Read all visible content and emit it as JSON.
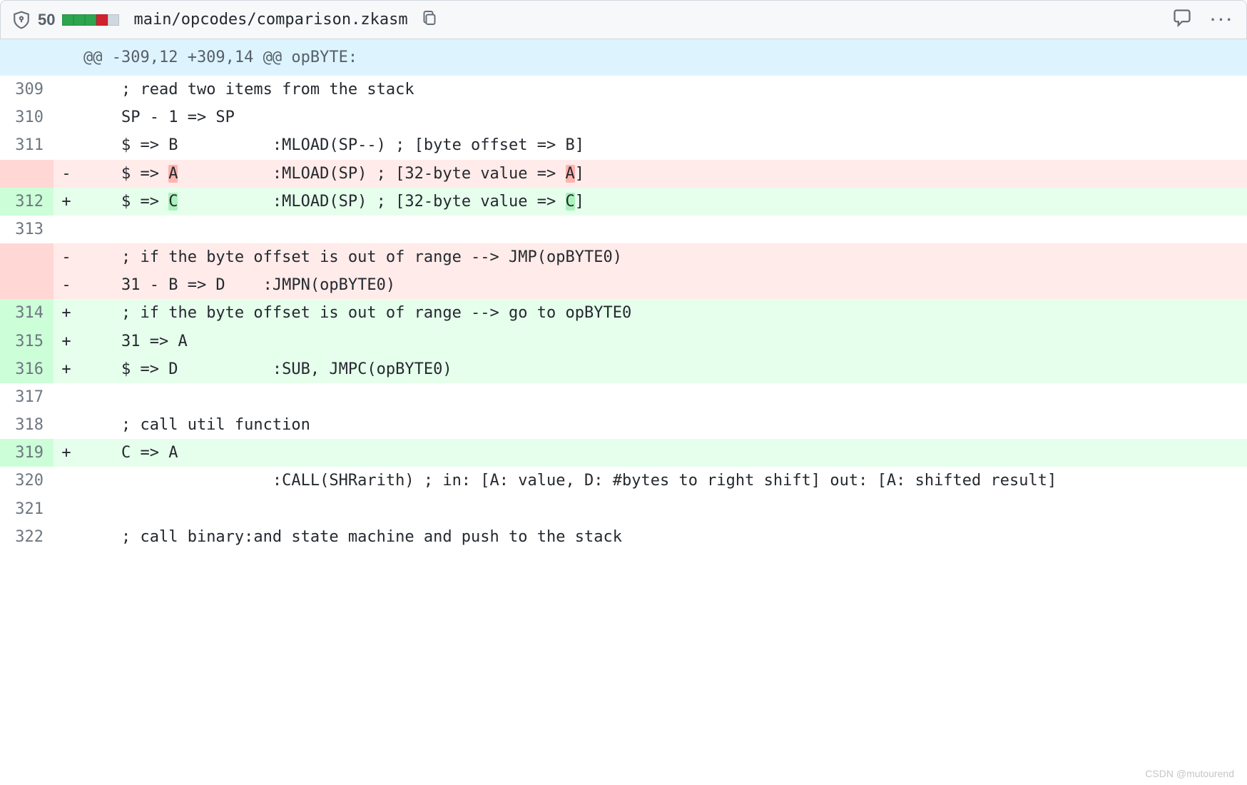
{
  "header": {
    "diff_count": "50",
    "file_path": "main/opcodes/comparison.zkasm"
  },
  "hunk_header": "@@ -309,12 +309,14 @@ opBYTE:",
  "lines": [
    {
      "num": "309",
      "marker": "",
      "type": "ctx",
      "code": "    ; read two items from the stack"
    },
    {
      "num": "310",
      "marker": "",
      "type": "ctx",
      "code": "    SP - 1 => SP"
    },
    {
      "num": "311",
      "marker": "",
      "type": "ctx",
      "code": "    $ => B          :MLOAD(SP--) ; [byte offset => B]"
    },
    {
      "num": "",
      "marker": "-",
      "type": "del",
      "segments": [
        {
          "t": "    $ => "
        },
        {
          "t": "A",
          "hl": "del"
        },
        {
          "t": "          :MLOAD(SP) ; [32-byte value => "
        },
        {
          "t": "A",
          "hl": "del"
        },
        {
          "t": "]"
        }
      ]
    },
    {
      "num": "312",
      "marker": "+",
      "type": "add",
      "segments": [
        {
          "t": "    $ => "
        },
        {
          "t": "C",
          "hl": "add"
        },
        {
          "t": "          :MLOAD(SP) ; [32-byte value => "
        },
        {
          "t": "C",
          "hl": "add"
        },
        {
          "t": "]"
        }
      ]
    },
    {
      "num": "313",
      "marker": "",
      "type": "ctx",
      "code": ""
    },
    {
      "num": "",
      "marker": "-",
      "type": "del",
      "code": "    ; if the byte offset is out of range --> JMP(opBYTE0)"
    },
    {
      "num": "",
      "marker": "-",
      "type": "del",
      "code": "    31 - B => D    :JMPN(opBYTE0)"
    },
    {
      "num": "314",
      "marker": "+",
      "type": "add",
      "code": "    ; if the byte offset is out of range --> go to opBYTE0"
    },
    {
      "num": "315",
      "marker": "+",
      "type": "add",
      "code": "    31 => A"
    },
    {
      "num": "316",
      "marker": "+",
      "type": "add",
      "code": "    $ => D          :SUB, JMPC(opBYTE0)"
    },
    {
      "num": "317",
      "marker": "",
      "type": "ctx",
      "code": ""
    },
    {
      "num": "318",
      "marker": "",
      "type": "ctx",
      "code": "    ; call util function"
    },
    {
      "num": "319",
      "marker": "+",
      "type": "add",
      "code": "    C => A"
    },
    {
      "num": "320",
      "marker": "",
      "type": "ctx",
      "code": "                    :CALL(SHRarith) ; in: [A: value, D: #bytes to right shift] out: [A: shifted result]"
    },
    {
      "num": "321",
      "marker": "",
      "type": "ctx",
      "code": ""
    },
    {
      "num": "322",
      "marker": "",
      "type": "ctx",
      "code": "    ; call binary:and state machine and push to the stack"
    }
  ],
  "watermark": "CSDN @mutourend"
}
